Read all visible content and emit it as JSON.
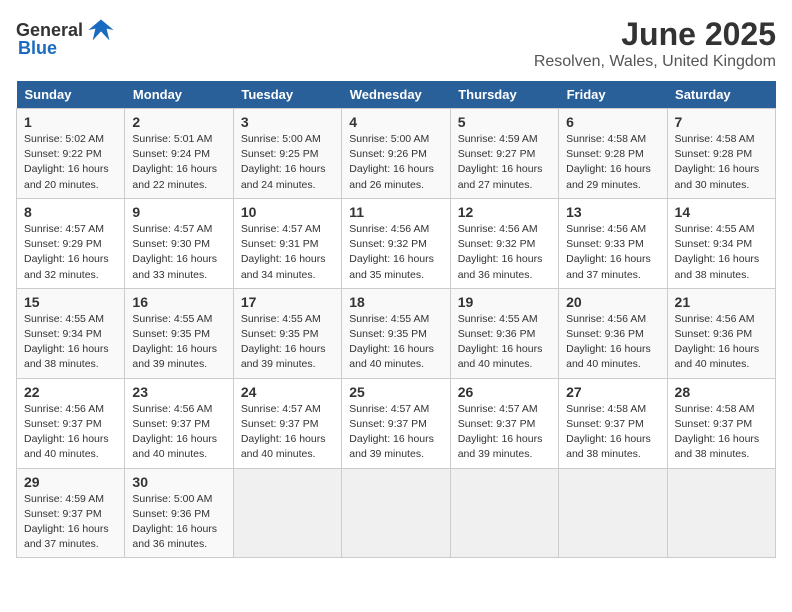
{
  "header": {
    "logo_general": "General",
    "logo_blue": "Blue",
    "title": "June 2025",
    "subtitle": "Resolven, Wales, United Kingdom"
  },
  "columns": [
    "Sunday",
    "Monday",
    "Tuesday",
    "Wednesday",
    "Thursday",
    "Friday",
    "Saturday"
  ],
  "weeks": [
    [
      {
        "day": "1",
        "info": "Sunrise: 5:02 AM\nSunset: 9:22 PM\nDaylight: 16 hours\nand 20 minutes."
      },
      {
        "day": "2",
        "info": "Sunrise: 5:01 AM\nSunset: 9:24 PM\nDaylight: 16 hours\nand 22 minutes."
      },
      {
        "day": "3",
        "info": "Sunrise: 5:00 AM\nSunset: 9:25 PM\nDaylight: 16 hours\nand 24 minutes."
      },
      {
        "day": "4",
        "info": "Sunrise: 5:00 AM\nSunset: 9:26 PM\nDaylight: 16 hours\nand 26 minutes."
      },
      {
        "day": "5",
        "info": "Sunrise: 4:59 AM\nSunset: 9:27 PM\nDaylight: 16 hours\nand 27 minutes."
      },
      {
        "day": "6",
        "info": "Sunrise: 4:58 AM\nSunset: 9:28 PM\nDaylight: 16 hours\nand 29 minutes."
      },
      {
        "day": "7",
        "info": "Sunrise: 4:58 AM\nSunset: 9:28 PM\nDaylight: 16 hours\nand 30 minutes."
      }
    ],
    [
      {
        "day": "8",
        "info": "Sunrise: 4:57 AM\nSunset: 9:29 PM\nDaylight: 16 hours\nand 32 minutes."
      },
      {
        "day": "9",
        "info": "Sunrise: 4:57 AM\nSunset: 9:30 PM\nDaylight: 16 hours\nand 33 minutes."
      },
      {
        "day": "10",
        "info": "Sunrise: 4:57 AM\nSunset: 9:31 PM\nDaylight: 16 hours\nand 34 minutes."
      },
      {
        "day": "11",
        "info": "Sunrise: 4:56 AM\nSunset: 9:32 PM\nDaylight: 16 hours\nand 35 minutes."
      },
      {
        "day": "12",
        "info": "Sunrise: 4:56 AM\nSunset: 9:32 PM\nDaylight: 16 hours\nand 36 minutes."
      },
      {
        "day": "13",
        "info": "Sunrise: 4:56 AM\nSunset: 9:33 PM\nDaylight: 16 hours\nand 37 minutes."
      },
      {
        "day": "14",
        "info": "Sunrise: 4:55 AM\nSunset: 9:34 PM\nDaylight: 16 hours\nand 38 minutes."
      }
    ],
    [
      {
        "day": "15",
        "info": "Sunrise: 4:55 AM\nSunset: 9:34 PM\nDaylight: 16 hours\nand 38 minutes."
      },
      {
        "day": "16",
        "info": "Sunrise: 4:55 AM\nSunset: 9:35 PM\nDaylight: 16 hours\nand 39 minutes."
      },
      {
        "day": "17",
        "info": "Sunrise: 4:55 AM\nSunset: 9:35 PM\nDaylight: 16 hours\nand 39 minutes."
      },
      {
        "day": "18",
        "info": "Sunrise: 4:55 AM\nSunset: 9:35 PM\nDaylight: 16 hours\nand 40 minutes."
      },
      {
        "day": "19",
        "info": "Sunrise: 4:55 AM\nSunset: 9:36 PM\nDaylight: 16 hours\nand 40 minutes."
      },
      {
        "day": "20",
        "info": "Sunrise: 4:56 AM\nSunset: 9:36 PM\nDaylight: 16 hours\nand 40 minutes."
      },
      {
        "day": "21",
        "info": "Sunrise: 4:56 AM\nSunset: 9:36 PM\nDaylight: 16 hours\nand 40 minutes."
      }
    ],
    [
      {
        "day": "22",
        "info": "Sunrise: 4:56 AM\nSunset: 9:37 PM\nDaylight: 16 hours\nand 40 minutes."
      },
      {
        "day": "23",
        "info": "Sunrise: 4:56 AM\nSunset: 9:37 PM\nDaylight: 16 hours\nand 40 minutes."
      },
      {
        "day": "24",
        "info": "Sunrise: 4:57 AM\nSunset: 9:37 PM\nDaylight: 16 hours\nand 40 minutes."
      },
      {
        "day": "25",
        "info": "Sunrise: 4:57 AM\nSunset: 9:37 PM\nDaylight: 16 hours\nand 39 minutes."
      },
      {
        "day": "26",
        "info": "Sunrise: 4:57 AM\nSunset: 9:37 PM\nDaylight: 16 hours\nand 39 minutes."
      },
      {
        "day": "27",
        "info": "Sunrise: 4:58 AM\nSunset: 9:37 PM\nDaylight: 16 hours\nand 38 minutes."
      },
      {
        "day": "28",
        "info": "Sunrise: 4:58 AM\nSunset: 9:37 PM\nDaylight: 16 hours\nand 38 minutes."
      }
    ],
    [
      {
        "day": "29",
        "info": "Sunrise: 4:59 AM\nSunset: 9:37 PM\nDaylight: 16 hours\nand 37 minutes."
      },
      {
        "day": "30",
        "info": "Sunrise: 5:00 AM\nSunset: 9:36 PM\nDaylight: 16 hours\nand 36 minutes."
      },
      {
        "day": "",
        "info": ""
      },
      {
        "day": "",
        "info": ""
      },
      {
        "day": "",
        "info": ""
      },
      {
        "day": "",
        "info": ""
      },
      {
        "day": "",
        "info": ""
      }
    ]
  ]
}
